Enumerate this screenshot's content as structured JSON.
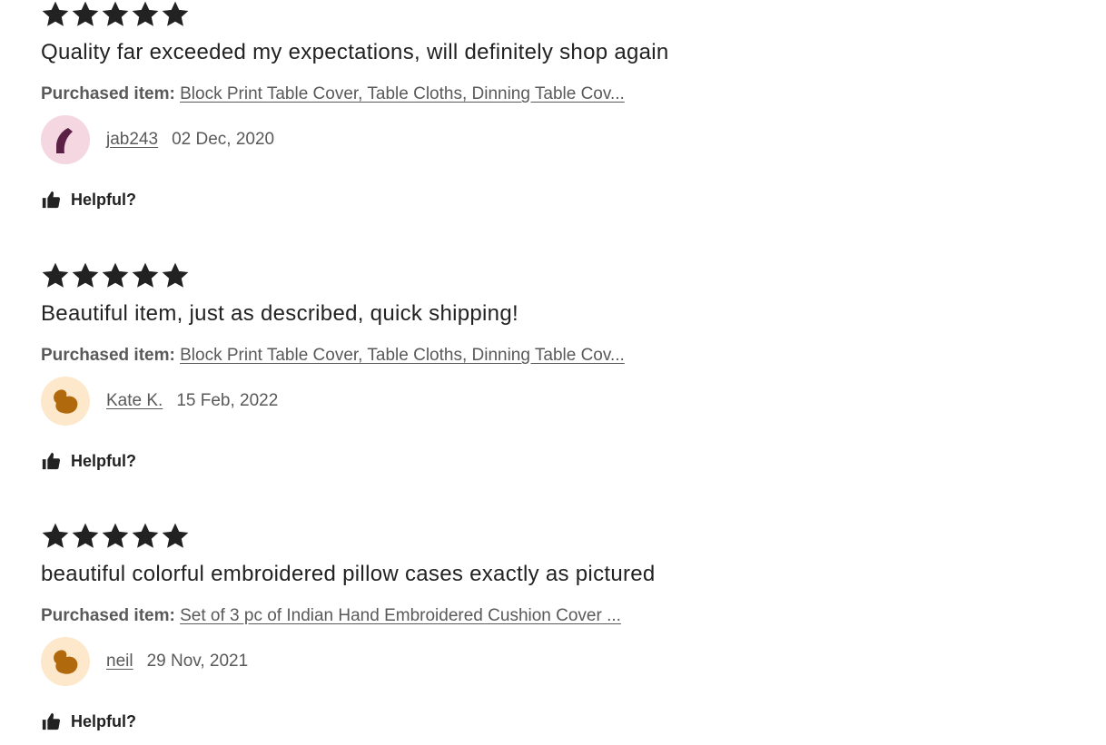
{
  "colors": {
    "star": "#222222",
    "text": "#222222",
    "muted": "#595959",
    "avatar_pink_bg": "#f4d7e1",
    "avatar_pink_fg": "#5b2245",
    "avatar_peach_bg": "#fde8cc",
    "avatar_peach_fg": "#b06a0d"
  },
  "reviews": [
    {
      "rating": 5,
      "text": "Quality far exceeded my expectations, will definitely shop again",
      "purchased_label": "Purchased item:",
      "purchased_item": "Block Print Table Cover, Table Cloths, Dinning Table Cov...",
      "reviewer": "jab243",
      "date": "02 Dec, 2020",
      "avatar_icon": "crescent-shape-icon",
      "helpful_label": "Helpful?"
    },
    {
      "rating": 5,
      "text": "Beautiful item, just as described, quick shipping!",
      "purchased_label": "Purchased item:",
      "purchased_item": "Block Print Table Cover, Table Cloths, Dinning Table Cov...",
      "reviewer": "Kate K.",
      "date": "15 Feb, 2022",
      "avatar_icon": "blob-shape-icon",
      "helpful_label": "Helpful?"
    },
    {
      "rating": 5,
      "text": "beautiful colorful embroidered pillow cases exactly as pictured",
      "purchased_label": "Purchased item:",
      "purchased_item": "Set of 3 pc of Indian Hand Embroidered Cushion Cover ...",
      "reviewer": "neil",
      "date": "29 Nov, 2021",
      "avatar_icon": "blob-shape-icon",
      "helpful_label": "Helpful?"
    }
  ]
}
